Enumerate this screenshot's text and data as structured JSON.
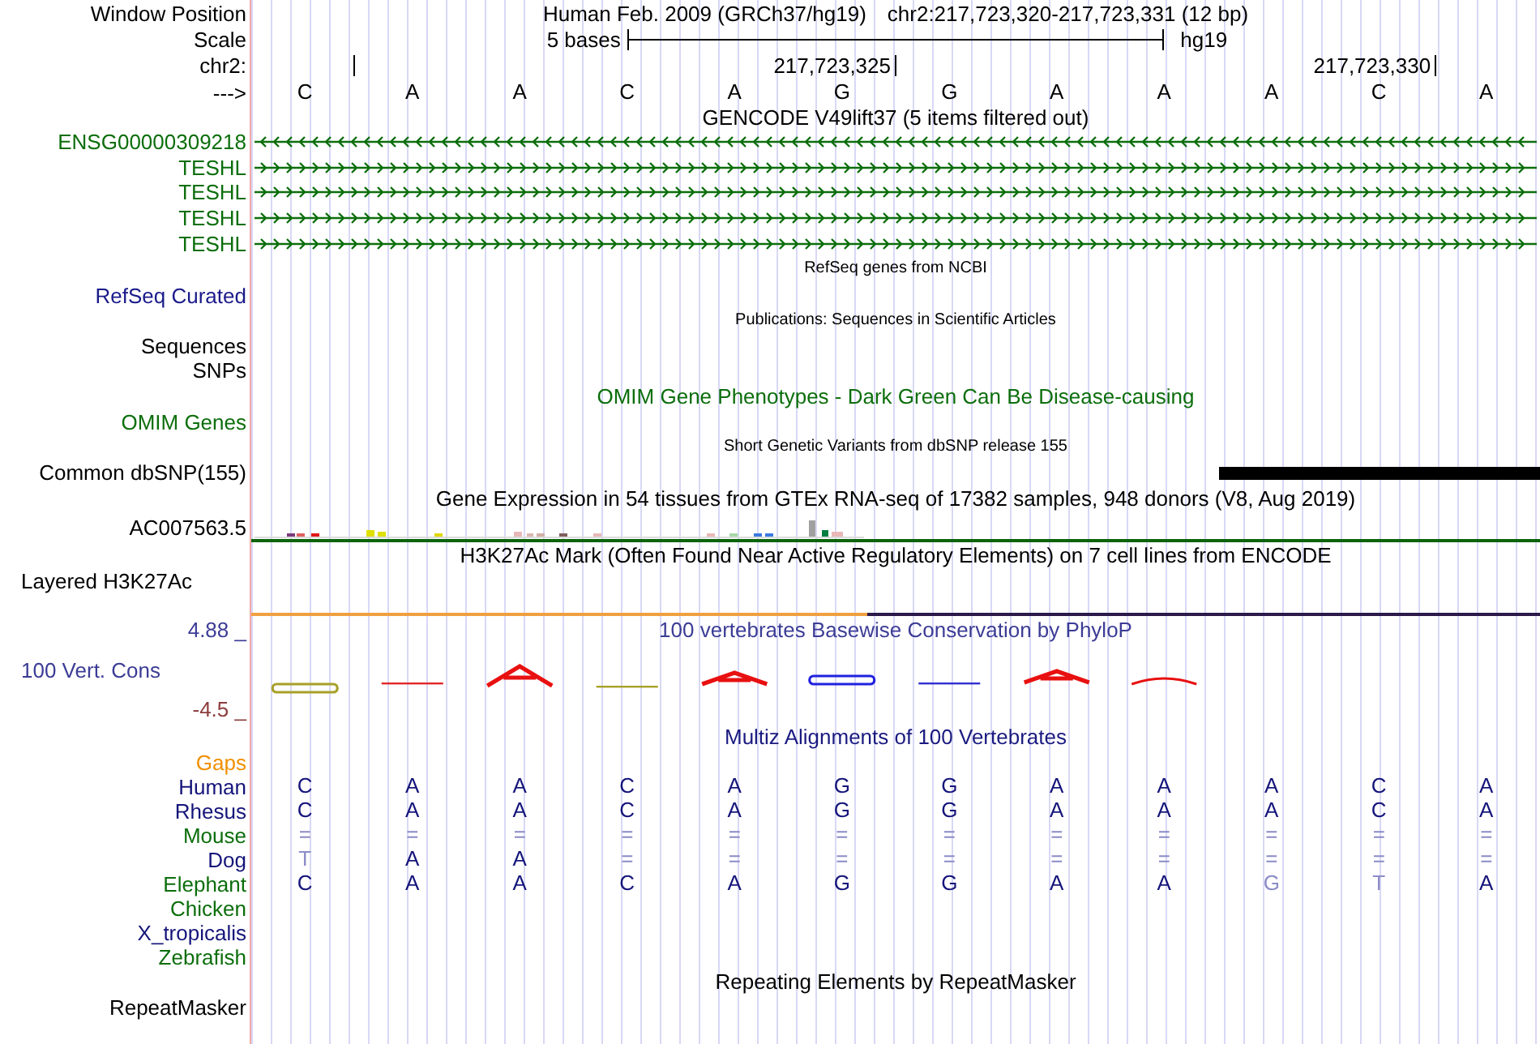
{
  "header": {
    "position_label": "Window Position",
    "assembly": "Human Feb. 2009 (GRCh37/hg19)",
    "position": "chr2:217,723,320-217,723,331 (12 bp)",
    "scale_label": "Scale",
    "scale_length": "5 bases",
    "scale_assembly": "hg19",
    "ruler_label": "chr2:",
    "ruler_ticks": [
      "217,723,325",
      "217,723,330"
    ],
    "strand_label": "--->",
    "bases": [
      "C",
      "A",
      "A",
      "C",
      "A",
      "G",
      "G",
      "A",
      "A",
      "A",
      "C",
      "A"
    ]
  },
  "tracks": [
    {
      "kind": "genes",
      "title": "GENCODE V49lift37 (5 items filtered out)",
      "color": "#000000",
      "items": [
        {
          "label": "ENSG00000309218",
          "reverse_strand": true,
          "color": "#0c6e0c"
        },
        {
          "label": "TESHL",
          "reverse_strand": false,
          "color": "#0c6e0c"
        },
        {
          "label": "TESHL",
          "reverse_strand": false,
          "color": "#0c6e0c"
        },
        {
          "label": "TESHL",
          "reverse_strand": false,
          "color": "#0c6e0c"
        },
        {
          "label": "TESHL",
          "reverse_strand": false,
          "color": "#0c6e0c"
        }
      ]
    },
    {
      "kind": "refseq",
      "title": "RefSeq genes from NCBI",
      "color": "#000000",
      "labels": [
        {
          "text": "RefSeq Curated",
          "color": "#1a1a8a"
        }
      ]
    },
    {
      "kind": "publications",
      "title": "Publications: Sequences in Scientific Articles",
      "color": "#000000",
      "labels": [
        {
          "text": "Sequences",
          "color": "#000000"
        },
        {
          "text": "SNPs",
          "color": "#000000"
        }
      ]
    },
    {
      "kind": "omim",
      "title": "OMIM Gene Phenotypes - Dark Green Can Be Disease-causing",
      "color": "#0c6e0c",
      "labels": [
        {
          "text": "OMIM Genes",
          "color": "#0c6e0c"
        }
      ]
    },
    {
      "kind": "variants",
      "title": "Short Genetic Variants from dbSNP release 155",
      "color": "#000000",
      "labels": [
        {
          "text": "Common dbSNP(155)",
          "color": "#000000"
        }
      ]
    },
    {
      "kind": "expression",
      "title": "Gene Expression in 54 tissues from GTEx RNA-seq of 17382 samples, 948 donors (V8, Aug 2019)",
      "color": "#000000",
      "labels": [
        {
          "text": "AC007563.5",
          "color": "#000000"
        }
      ]
    },
    {
      "kind": "signal",
      "title": "H3K27Ac Mark (Often Found Near Active Regulatory Elements) on 7 cell lines from ENCODE",
      "color": "#000000",
      "labels": [
        {
          "text": "Layered H3K27Ac",
          "color": "#000000"
        }
      ]
    },
    {
      "kind": "conservation",
      "title": "100 vertebrates Basewise Conservation by PhyloP",
      "color": "#3c3c96",
      "labels": [
        {
          "text": "100 Vert. Cons",
          "color": "#3c3c96"
        }
      ],
      "axis": [
        {
          "text": "4.88 _",
          "color": "#3c3c96"
        },
        {
          "text": "-4.5 _",
          "color": "#8c3c3c"
        }
      ]
    },
    {
      "kind": "alignment",
      "title": "Multiz Alignments of 100 Vertebrates",
      "color": "#1a1a80",
      "rows": [
        {
          "name": "Gaps",
          "color": "#f09000"
        },
        {
          "name": "Human",
          "color": "#14147a",
          "bases": [
            {
              "base": "C",
              "faint": false
            },
            {
              "base": "A",
              "faint": false
            },
            {
              "base": "A",
              "faint": false
            },
            {
              "base": "C",
              "faint": false
            },
            {
              "base": "A",
              "faint": false
            },
            {
              "base": "G",
              "faint": false
            },
            {
              "base": "G",
              "faint": false
            },
            {
              "base": "A",
              "faint": false
            },
            {
              "base": "A",
              "faint": false
            },
            {
              "base": "A",
              "faint": false
            },
            {
              "base": "C",
              "faint": false
            },
            {
              "base": "A",
              "faint": false
            }
          ]
        },
        {
          "name": "Rhesus",
          "color": "#14147a",
          "bases": [
            {
              "base": "C",
              "faint": false
            },
            {
              "base": "A",
              "faint": false
            },
            {
              "base": "A",
              "faint": false
            },
            {
              "base": "C",
              "faint": false
            },
            {
              "base": "A",
              "faint": false
            },
            {
              "base": "G",
              "faint": false
            },
            {
              "base": "G",
              "faint": false
            },
            {
              "base": "A",
              "faint": false
            },
            {
              "base": "A",
              "faint": false
            },
            {
              "base": "A",
              "faint": false
            },
            {
              "base": "C",
              "faint": false
            },
            {
              "base": "A",
              "faint": false
            }
          ]
        },
        {
          "name": "Mouse",
          "color": "#0c6e0c",
          "bases": [
            {
              "base": "=",
              "faint": true
            },
            {
              "base": "=",
              "faint": true
            },
            {
              "base": "=",
              "faint": true
            },
            {
              "base": "=",
              "faint": true
            },
            {
              "base": "=",
              "faint": true
            },
            {
              "base": "=",
              "faint": true
            },
            {
              "base": "=",
              "faint": true
            },
            {
              "base": "=",
              "faint": true
            },
            {
              "base": "=",
              "faint": true
            },
            {
              "base": "=",
              "faint": true
            },
            {
              "base": "=",
              "faint": true
            },
            {
              "base": "=",
              "faint": true
            }
          ]
        },
        {
          "name": "Dog",
          "color": "#14147a",
          "bases": [
            {
              "base": "T",
              "faint": true
            },
            {
              "base": "A",
              "faint": false
            },
            {
              "base": "A",
              "faint": false
            },
            {
              "base": "=",
              "faint": true
            },
            {
              "base": "=",
              "faint": true
            },
            {
              "base": "=",
              "faint": true
            },
            {
              "base": "=",
              "faint": true
            },
            {
              "base": "=",
              "faint": true
            },
            {
              "base": "=",
              "faint": true
            },
            {
              "base": "=",
              "faint": true
            },
            {
              "base": "=",
              "faint": true
            },
            {
              "base": "=",
              "faint": true
            }
          ]
        },
        {
          "name": "Elephant",
          "color": "#0c6e0c",
          "bases": [
            {
              "base": "C",
              "faint": false
            },
            {
              "base": "A",
              "faint": false
            },
            {
              "base": "A",
              "faint": false
            },
            {
              "base": "C",
              "faint": false
            },
            {
              "base": "A",
              "faint": false
            },
            {
              "base": "G",
              "faint": false
            },
            {
              "base": "G",
              "faint": false
            },
            {
              "base": "A",
              "faint": false
            },
            {
              "base": "A",
              "faint": false
            },
            {
              "base": "G",
              "faint": true
            },
            {
              "base": "T",
              "faint": true
            },
            {
              "base": "A",
              "faint": false
            }
          ]
        },
        {
          "name": "Chicken",
          "color": "#0c6e0c"
        },
        {
          "name": "X_tropicalis",
          "color": "#14147a"
        },
        {
          "name": "Zebrafish",
          "color": "#0c6e0c"
        }
      ]
    },
    {
      "kind": "repeats",
      "title": "Repeating Elements by RepeatMasker",
      "color": "#000000",
      "labels": [
        {
          "text": "RepeatMasker",
          "color": "#000000"
        }
      ]
    }
  ]
}
